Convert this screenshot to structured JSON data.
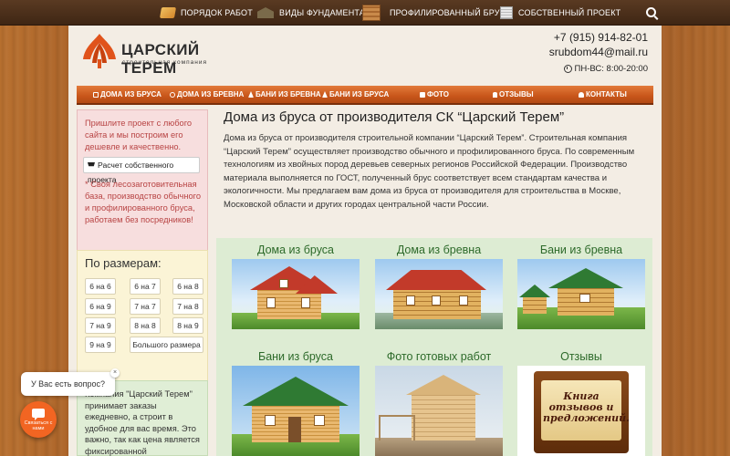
{
  "topnav": {
    "items": [
      {
        "label": "ПОРЯДОК РАБОТ",
        "icon": "book-icon"
      },
      {
        "label": "ВИДЫ ФУНДАМЕНТА",
        "icon": "foundation-icon"
      },
      {
        "label": "ПРОФИЛИРОВАННЫЙ БРУС",
        "icon": "beam-icon"
      },
      {
        "label": "СОБСТВЕННЫЙ ПРОЕКТ",
        "icon": "project-icon"
      }
    ]
  },
  "header": {
    "logo_title": "ЦАРСКИЙ ТЕРЕМ",
    "logo_subtitle": "строительная компания",
    "phone": "+7 (915) 914-82-01",
    "email": "srubdom44@mail.ru",
    "hours": "ПН-ВС: 8:00-20:00"
  },
  "menu": {
    "items": [
      {
        "label": "ДОМА ИЗ БРУСА"
      },
      {
        "label": "ДОМА ИЗ БРЕВНА"
      },
      {
        "label": "БАНИ ИЗ БРЕВНА"
      },
      {
        "label": "БАНИ ИЗ БРУСА"
      },
      {
        "label": "ФОТО"
      },
      {
        "label": "ОТЗЫВЫ"
      },
      {
        "label": "КОНТАКТЫ"
      }
    ]
  },
  "promo": {
    "text1": "Пришлите проект с любого сайта и мы построим его дешевле и качественно.",
    "button": "Расчет собственного проекта",
    "text2": "* Своя лесозаготовительная база, производство обычного и профилированного бруса, работаем без посредников!"
  },
  "sizes": {
    "title": "По размерам:",
    "items": [
      "6 на 6",
      "6 на 7",
      "6 на 8",
      "6 на 9",
      "7 на 7",
      "7 на 8",
      "7 на 9",
      "8 на 8",
      "8 на 9",
      "9 на 9",
      "Большого размера"
    ]
  },
  "info": {
    "text": "Компания \"Царский Терем\" принимает заказы ежедневно, а строит в удобное для вас время. Это важно, так как цена является фиксированной"
  },
  "content": {
    "title": "Дома из бруса от производителя СК “Царский Терем”",
    "body": "Дома из бруса от производителя строительной компании “Царский Терем”. Строительная компания “Царский Терем” осуществляет производство обычного и профилированного бруса. По современным технологиям из хвойных пород деревьев северных регионов Российской Федерации. Производство материала выполняется по ГОСТ, полученный брус соответствует всем стандартам качества и экологичности. Мы предлагаем вам дома из бруса от производителя для строительства в Москве, Московской области и других городах центральной части России."
  },
  "gallery": {
    "tiles": [
      {
        "label": "Дома из бруса"
      },
      {
        "label": "Дома из бревна"
      },
      {
        "label": "Бани из бревна"
      },
      {
        "label": "Бани из бруса"
      },
      {
        "label": "Фото готовых работ"
      },
      {
        "label": "Отзывы"
      }
    ],
    "book_text": "Книга отзывов и предложений."
  },
  "chat": {
    "bubble": "У Вас есть вопрос?",
    "close": "×",
    "button": "Связаться с нами"
  },
  "colors": {
    "menu_accent": "#d4621f",
    "promo_text": "#b84444",
    "gallery_label": "#2d6a2a",
    "chat_button": "#f26522"
  }
}
